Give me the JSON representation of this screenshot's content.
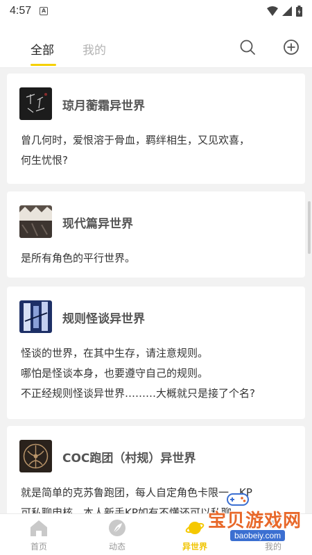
{
  "status_bar": {
    "time": "4:57",
    "notification_icon": "A",
    "icons": [
      "wifi-icon",
      "signal-icon",
      "battery-icon"
    ]
  },
  "header": {
    "tabs": [
      {
        "label": "全部",
        "active": true
      },
      {
        "label": "我的",
        "active": false
      }
    ],
    "icons": [
      "search-icon",
      "add-circle-icon"
    ],
    "accent_color": "#f5d000"
  },
  "worlds": [
    {
      "title": "琼月蘅霜异世界",
      "desc_lines": [
        "曾几何时，爱恨溶于骨血，羁绊相生，又见欢喜，",
        "何生忧恨?"
      ]
    },
    {
      "title": "现代篇异世界",
      "desc_lines": [
        "是所有角色的平行世界。"
      ]
    },
    {
      "title": "规则怪谈异世界",
      "desc_lines": [
        "怪谈的世界，在其中生存，请注意规则。",
        "哪怕是怪谈本身，也要遵守自己的规则。",
        "不正经规则怪谈异世界………大概就只是接了个名?"
      ]
    },
    {
      "title": "COC跑团（村规）异世界",
      "desc_lines": [
        "就是简单的克苏鲁跑团，每人自定角色卡限一，KP",
        "可私聊申核，本人新手KP如有不懂还可以私聊"
      ]
    }
  ],
  "bottom_nav": [
    {
      "label": "首页",
      "icon": "home-icon",
      "active": false
    },
    {
      "label": "动态",
      "icon": "feather-icon",
      "active": false
    },
    {
      "label": "异世界",
      "icon": "planet-icon",
      "active": true
    },
    {
      "label": "我的",
      "icon": "profile-icon",
      "active": false
    }
  ],
  "watermark": {
    "text": "宝贝游戏网",
    "url": "baobeiy.com"
  }
}
